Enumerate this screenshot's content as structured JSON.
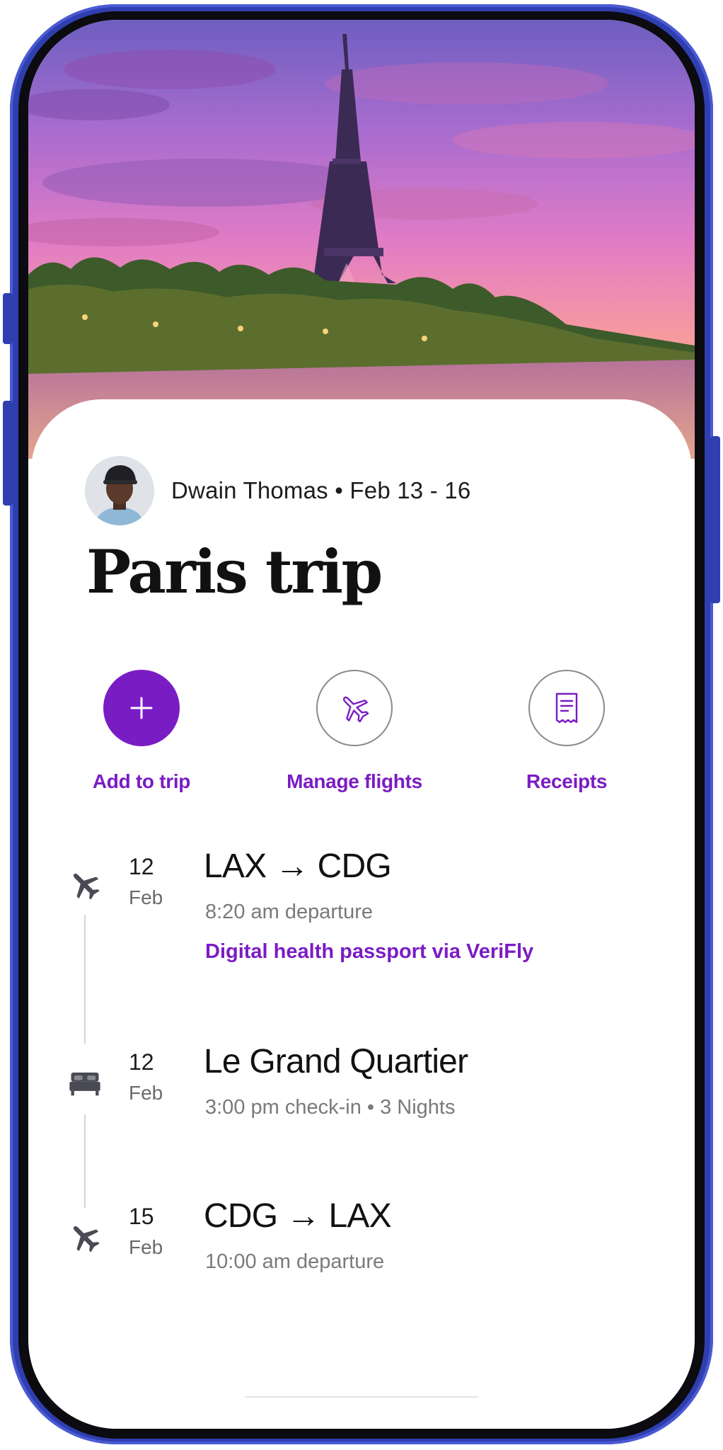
{
  "trip": {
    "traveler_name": "Dwain Thomas",
    "separator": "•",
    "dates": "Feb 13 - 16",
    "title": "Paris trip"
  },
  "actions": [
    {
      "label": "Add to trip",
      "icon": "plus-icon"
    },
    {
      "label": "Manage flights",
      "icon": "airplane-icon"
    },
    {
      "label": "Receipts",
      "icon": "receipt-icon"
    }
  ],
  "itinerary": [
    {
      "type": "flight",
      "icon": "airplane-icon",
      "day": "12",
      "month": "Feb",
      "title": "LAX → CDG",
      "subtitle": "8:20 am departure",
      "link": "Digital health passport via VeriFly"
    },
    {
      "type": "hotel",
      "icon": "bed-icon",
      "day": "12",
      "month": "Feb",
      "title": "Le Grand Quartier",
      "subtitle": "3:00 pm check-in • 3 Nights"
    },
    {
      "type": "flight",
      "icon": "airplane-icon",
      "day": "15",
      "month": "Feb",
      "title": "CDG → LAX",
      "subtitle": "10:00 am departure"
    }
  ],
  "colors": {
    "accent": "#7a1cc4",
    "frame": "#2f3fb0",
    "text_primary": "#111111",
    "text_secondary": "#7a7a7a"
  }
}
